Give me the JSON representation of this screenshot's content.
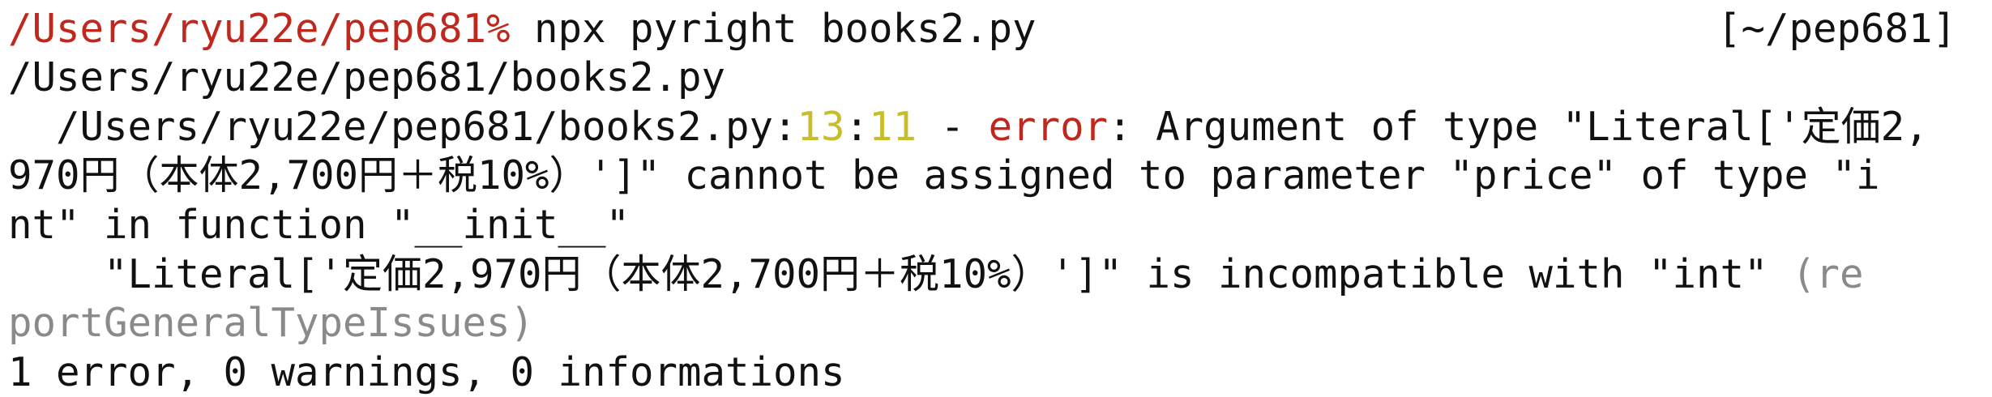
{
  "colors": {
    "prompt_path": "#c0281e",
    "line_col_numbers": "#c8bd2a",
    "error_keyword": "#c0281e",
    "rule_name": "#8a8a8a",
    "text": "#111111",
    "background": "#ffffff"
  },
  "prompt": {
    "path": "/Users/ryu22e/pep681%",
    "command": " npx pyright books2.py",
    "right_prompt": "[~/pep681]"
  },
  "output": {
    "file_path": "/Users/ryu22e/pep681/books2.py",
    "diagnostic": {
      "indent": "  ",
      "location": "/Users/ryu22e/pep681/books2.py",
      "sep1": ":",
      "line": "13",
      "sep2": ":",
      "column": "11",
      "dash": " - ",
      "severity": "error",
      "message_line1": ": Argument of type \"Literal['定価2,",
      "message_line2": "970円（本体2,700円＋税10%）']\" cannot be assigned to parameter \"price\" of type \"i",
      "message_line3": "nt\" in function \"__init__\"",
      "detail_line1": "    \"Literal['定価2,970円（本体2,700円＋税10%）']\" is incompatible with \"int\" ",
      "rule_part1": "(re",
      "rule_part2": "portGeneralTypeIssues)"
    },
    "summary": "1 error, 0 warnings, 0 informations"
  }
}
